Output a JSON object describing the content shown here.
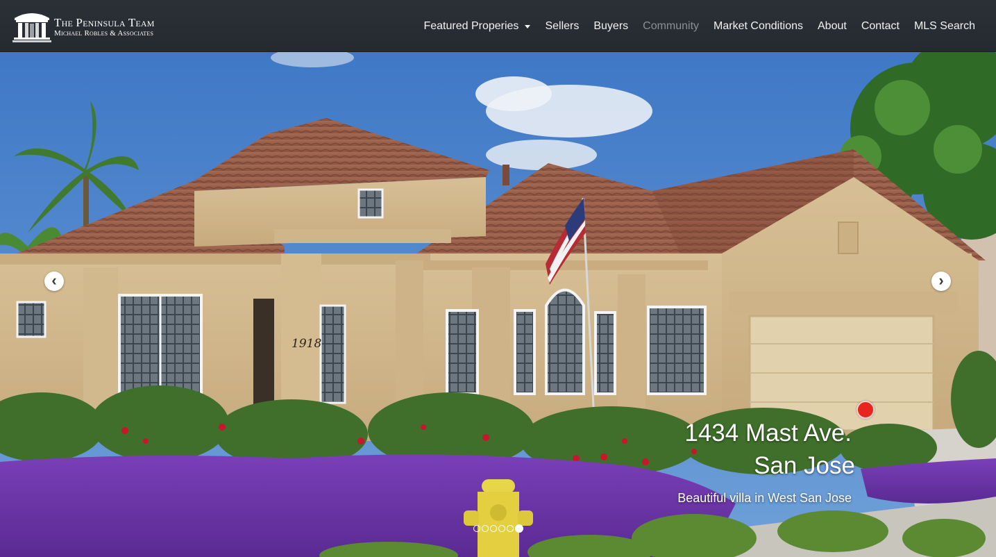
{
  "brand": {
    "title": "The Peninsula Team",
    "subtitle": "Michael Robles & Associates",
    "logo_icon": "columns-pavilion-icon"
  },
  "nav": {
    "items": [
      {
        "label": "Featured Properies",
        "dropdown": true,
        "active": false
      },
      {
        "label": "Sellers",
        "dropdown": false,
        "active": false
      },
      {
        "label": "Buyers",
        "dropdown": false,
        "active": false
      },
      {
        "label": "Community",
        "dropdown": false,
        "active": true
      },
      {
        "label": "Market Conditions",
        "dropdown": false,
        "active": false
      },
      {
        "label": "About",
        "dropdown": false,
        "active": false
      },
      {
        "label": "Contact",
        "dropdown": false,
        "active": false
      },
      {
        "label": "MLS Search",
        "dropdown": false,
        "active": false
      }
    ]
  },
  "hero": {
    "house_number": "1918",
    "caption": {
      "line1": "1434 Mast Ave.",
      "line2": "San Jose",
      "description": "Beautiful villa in West San Jose"
    },
    "prev_icon": "chevron-left-icon",
    "next_icon": "chevron-right-icon",
    "prev_glyph": "‹",
    "next_glyph": "›",
    "slides_total": 6,
    "active_slide": 6
  },
  "colors": {
    "navbar": "#262a30",
    "nav_text": "#f2f2f2",
    "nav_muted": "#8a8f96",
    "red_marker": "#e8241e"
  }
}
